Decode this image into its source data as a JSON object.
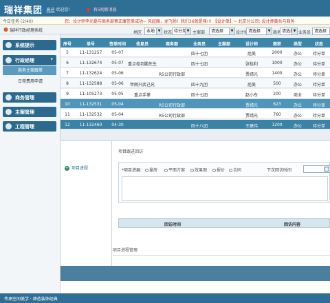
{
  "header": {
    "logo": "瑞祥集团",
    "user_prefix": "高迪",
    "user_greeting": "欢迎您!",
    "new_message": "有5则新消息"
  },
  "ticker": {
    "label": "今日任务 (2/40)",
    "text": "您：设计师李光磊与商务部蔡正康签单成功~   风起雁，龙飞扬！我们36就是强!!!   【设计单】~ 北京分公司: 设计师黄兵与商务"
  },
  "breadcrumb": "瑞祥行政经理系统",
  "sidebar": {
    "items": [
      {
        "label": "系统提示"
      },
      {
        "label": "行政经理"
      },
      {
        "label": "商务主案跟单"
      },
      {
        "label": "日常费用申请"
      },
      {
        "label": "商务管理"
      },
      {
        "label": "主案管理"
      },
      {
        "label": "工程管理"
      }
    ]
  },
  "filters": {
    "region_label": "地区",
    "region_value": "本地",
    "status_label": "状态",
    "status_value": "待分单",
    "owner_label": "主案部",
    "owner_value": "请选择",
    "designer_label": "设计师",
    "designer_value": "请选择",
    "biz_label": "商务",
    "biz_value": "请选择",
    "salesman_label": "业务员",
    "salesman_value": "请选择"
  },
  "table": {
    "headers": [
      "序号",
      "单号",
      "签单时间",
      "信息员",
      "商务部",
      "业务员",
      "主案部",
      "设计师",
      "面积",
      "类型",
      "状态"
    ],
    "rows": [
      [
        "5",
        "11-131257",
        "05-07",
        "",
        "",
        "四十七团",
        "",
        "屈美",
        "2000",
        "办公",
        "待分单"
      ],
      [
        "6",
        "11-132674",
        "05-07",
        "重点桂到鹏先生",
        "",
        "四十七团",
        "",
        "张桂利",
        "1000",
        "办公",
        "待分单"
      ],
      [
        "7",
        "11-132624",
        "05-06",
        "",
        "R5公司行政部",
        "",
        "",
        "贾靖光",
        "1400",
        "办公",
        "待分单"
      ],
      [
        "8",
        "11-132588",
        "05-06",
        "甲雨兴武己兄",
        "",
        "四十九团",
        "",
        "屈美",
        "500",
        "办公",
        "待分单"
      ],
      [
        "9",
        "11-105273",
        "05-05",
        "重点手掌",
        "",
        "四十七团",
        "",
        "赵小东",
        "200",
        "商业",
        "待分单"
      ],
      [
        "10",
        "11-132531",
        "05-04",
        "",
        "R5公司行政部",
        "",
        "",
        "贾靖光",
        "623",
        "办公",
        "待分单"
      ],
      [
        "11",
        "11-132532",
        "05-04",
        "",
        "R5公司行政部",
        "",
        "",
        "贾靖光",
        "760",
        "办公",
        "待分单"
      ],
      [
        "12",
        "11-132460",
        "04-30",
        "",
        "",
        "四十八团",
        "",
        "王建伟",
        "1200",
        "办公",
        "待分单"
      ]
    ]
  },
  "detail": {
    "progress_link": "项目进程",
    "section_title": "项目跟进回访",
    "progress_label": "*项目进展:",
    "options": [
      "量房",
      "平面方案",
      "效果图",
      "报价",
      "合同"
    ],
    "next_visit_label": "下次回访时间",
    "col_visit_time": "回访时间",
    "col_visit_content": "回访内容",
    "management_title": "项目进程管理"
  },
  "footer": "传承空间美学 · 缔造装饰经典"
}
